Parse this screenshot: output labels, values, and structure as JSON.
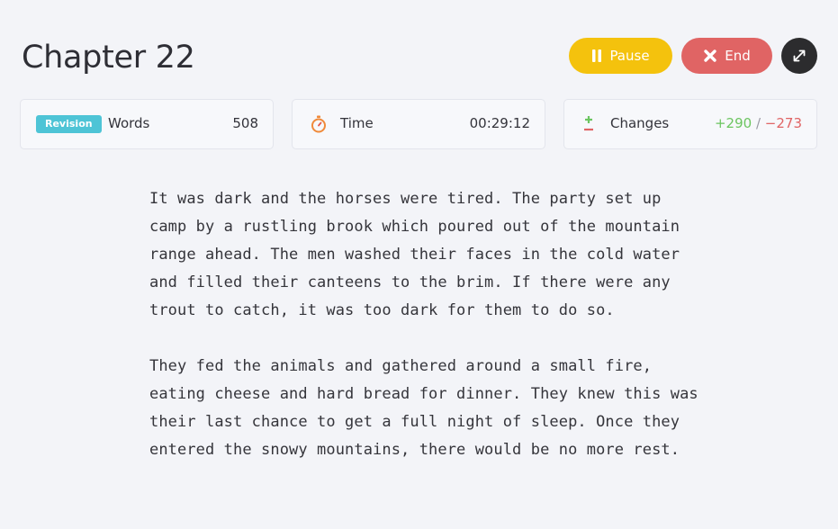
{
  "chapter": {
    "title": "Chapter 22"
  },
  "controls": {
    "pause_label": "Pause",
    "end_label": "End"
  },
  "stats": {
    "words": {
      "badge": "Revision",
      "label": "Words",
      "value": "508"
    },
    "time": {
      "label": "Time",
      "value": "00:29:12"
    },
    "changes": {
      "label": "Changes",
      "added": "+290",
      "separator": "/",
      "removed": "−273"
    }
  },
  "manuscript": {
    "paragraphs": [
      "It was dark and the horses were tired. The party set up camp by a rustling brook which poured out of the mountain range ahead. The men washed their faces in the cold water and filled their canteens to the brim. If there were any trout to catch, it was too dark for them to do so.",
      "They fed the animals and gathered around a small fire, eating cheese and hard bread for dinner. They knew this was their last chance to get a full night of sleep. Once they entered the snowy mountains, there would be no more rest."
    ]
  },
  "colors": {
    "pause": "#f4c20d",
    "end": "#e06464",
    "expand": "#2c2c2e",
    "badge": "#4ec4d6",
    "added": "#6cc560",
    "removed": "#e06464",
    "background": "#f3f4f8"
  },
  "icons": {
    "pause": "pause-icon",
    "end": "close-icon",
    "expand": "expand-icon",
    "time": "stopwatch-icon",
    "changes": "plus-minus-icon"
  }
}
